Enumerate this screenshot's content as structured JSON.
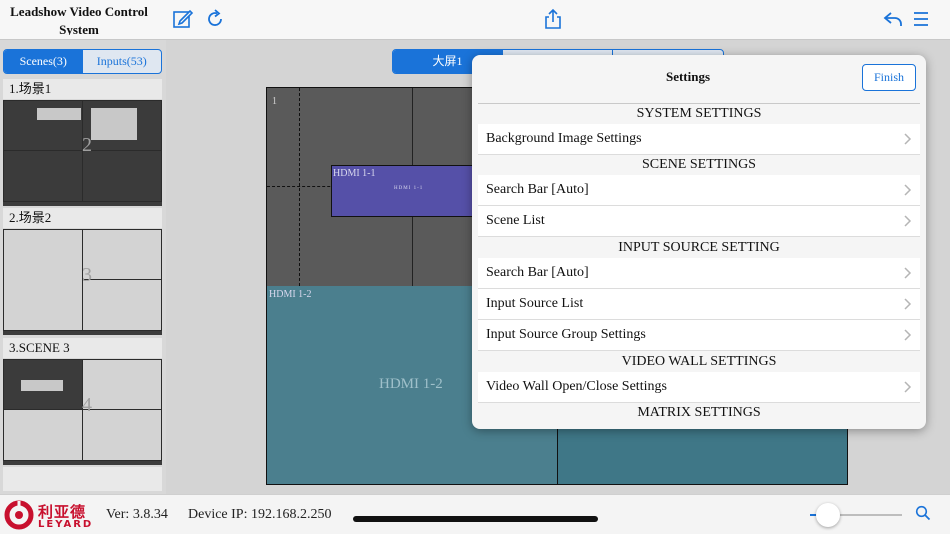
{
  "app": {
    "title": "Leadshow Video Control System",
    "toolbar_icons": [
      "edit-icon",
      "refresh-icon",
      "share-icon",
      "undo-icon",
      "menu-icon"
    ]
  },
  "left_panel": {
    "tabs": [
      {
        "label": "Scenes(3)",
        "active": true
      },
      {
        "label": "Inputs(53)",
        "active": false
      }
    ],
    "scenes": [
      {
        "name": "1.场景1",
        "number": "2"
      },
      {
        "name": "2.场景2",
        "number": "3"
      },
      {
        "name": "3.SCENE 3",
        "number": "4"
      }
    ]
  },
  "main": {
    "screen_tabs": [
      {
        "label": "大屏1",
        "active": true
      },
      {
        "label": "",
        "active": false
      },
      {
        "label": "",
        "active": false
      }
    ],
    "cell_label": "1",
    "windows": [
      {
        "label": "HDMI 1-1",
        "center": "HDMI 1-1",
        "color": "#5550a8"
      },
      {
        "label": "HDMI 1-2",
        "center": "HDMI 1-2",
        "color": "#4b7f8e"
      }
    ]
  },
  "settings": {
    "title": "Settings",
    "finish_label": "Finish",
    "sections": [
      {
        "header": "SYSTEM SETTINGS",
        "rows": [
          "Background Image Settings"
        ]
      },
      {
        "header": "SCENE SETTINGS",
        "rows": [
          "Search Bar [Auto]",
          "Scene List"
        ]
      },
      {
        "header": "INPUT SOURCE SETTING",
        "rows": [
          "Search Bar [Auto]",
          "Input Source List",
          "Input Source Group Settings"
        ]
      },
      {
        "header": "VIDEO WALL SETTINGS",
        "rows": [
          "Video Wall Open/Close Settings"
        ]
      },
      {
        "header": "MATRIX SETTINGS",
        "rows": []
      }
    ]
  },
  "footer": {
    "logo_cn": "利亚德",
    "logo_en": "LEYARD",
    "version": "Ver: 3.8.34",
    "device_ip": "Device IP: 192.168.2.250",
    "zoom_level": 0.2
  },
  "colors": {
    "accent": "#1a73d9",
    "brand": "#c8102e"
  }
}
